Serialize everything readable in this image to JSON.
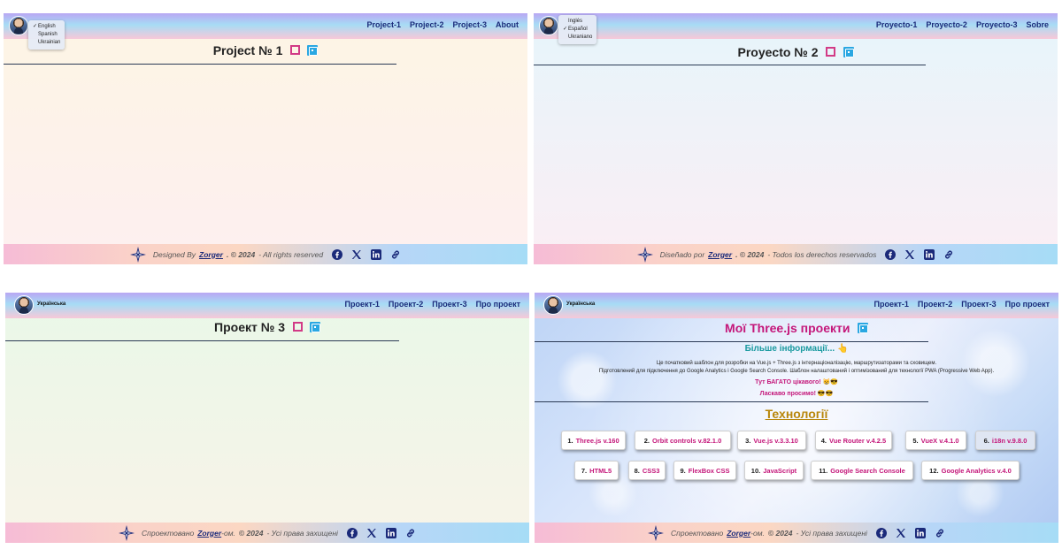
{
  "panels": {
    "en": {
      "nav": [
        "Project-1",
        "Project-2",
        "Project-3",
        "About"
      ],
      "languages": [
        "English",
        "Spanish",
        "Ukrainian"
      ],
      "selected_language": "English",
      "title": "Project № 1",
      "footer": {
        "prefix": "Designed By",
        "name": "Zorger",
        "year": ". © 2024",
        "suffix": "- All rights reserved"
      }
    },
    "es": {
      "nav": [
        "Proyecto-1",
        "Proyecto-2",
        "Proyecto-3",
        "Sobre"
      ],
      "languages": [
        "Inglés",
        "Español",
        "Ukraniano"
      ],
      "selected_language": "Español",
      "title": "Proyecto № 2",
      "footer": {
        "prefix": "Diseñado por",
        "name": "Zorger",
        "year": ". © 2024",
        "suffix": "- Todos los derechos reservados"
      }
    },
    "uk3": {
      "nav": [
        "Проект-1",
        "Проект-2",
        "Проект-3",
        "Про проект"
      ],
      "selected_language": "Українська",
      "title": "Проект № 3",
      "footer": {
        "prefix": "Спроектовано",
        "name": "Zorger",
        "name_suffix": "-ом.",
        "year": " © 2024",
        "suffix": "- Усі права захищені"
      }
    },
    "uk4": {
      "nav": [
        "Проект-1",
        "Проект-2",
        "Проект-3",
        "Про проект"
      ],
      "selected_language": "Українська",
      "title": "Мої Three.js проекти",
      "more_info": "Більше інформації...",
      "desc1": "Це початковий шаблон для розробки на Vue.js + Three.js з інтернаціоналізацію, маршрутизаторами та сховищем.",
      "desc2": "Підготовлений для підключення до Google Analytics і Google Search Console. Шаблон налаштований і оптимізований для технології PWA (Progressive Web App).",
      "line1": "Тут БАГАТО цікавого! 😸😎",
      "line2": "Ласкаво просимо! 😎😎",
      "tech_title": "Технології",
      "techs": [
        {
          "n": "1.",
          "t": "Three.js v.160"
        },
        {
          "n": "2.",
          "t": "Orbit controls v.82.1.0"
        },
        {
          "n": "3.",
          "t": "Vue.js v.3.3.10"
        },
        {
          "n": "4.",
          "t": "Vue Router v.4.2.5"
        },
        {
          "n": "5.",
          "t": "VueX v.4.1.0"
        },
        {
          "n": "6.",
          "t": "i18n v.9.8.0"
        },
        {
          "n": "7.",
          "t": "HTML5"
        },
        {
          "n": "8.",
          "t": "CSS3"
        },
        {
          "n": "9.",
          "t": "FlexBox CSS"
        },
        {
          "n": "10.",
          "t": "JavaScript"
        },
        {
          "n": "11.",
          "t": "Google Search Console"
        },
        {
          "n": "12.",
          "t": "Google Analytics v.4.0"
        }
      ],
      "footer": {
        "prefix": "Спроектовано",
        "name": "Zorger",
        "name_suffix": "-ом.",
        "year": " © 2024",
        "suffix": "- Усі права захищені"
      }
    }
  },
  "icons": {
    "social": [
      "facebook-icon",
      "x-icon",
      "linkedin-icon",
      "link-icon"
    ],
    "title": [
      "selection-icon",
      "expand-icon",
      "grid-icon"
    ],
    "logo": "compass-logo"
  },
  "colors": {
    "nav": "#1b2a7a",
    "accent_pink": "#c4177a",
    "teal": "#1a9aa0",
    "gold": "#b8860b",
    "expand": "#2aa7e2"
  }
}
